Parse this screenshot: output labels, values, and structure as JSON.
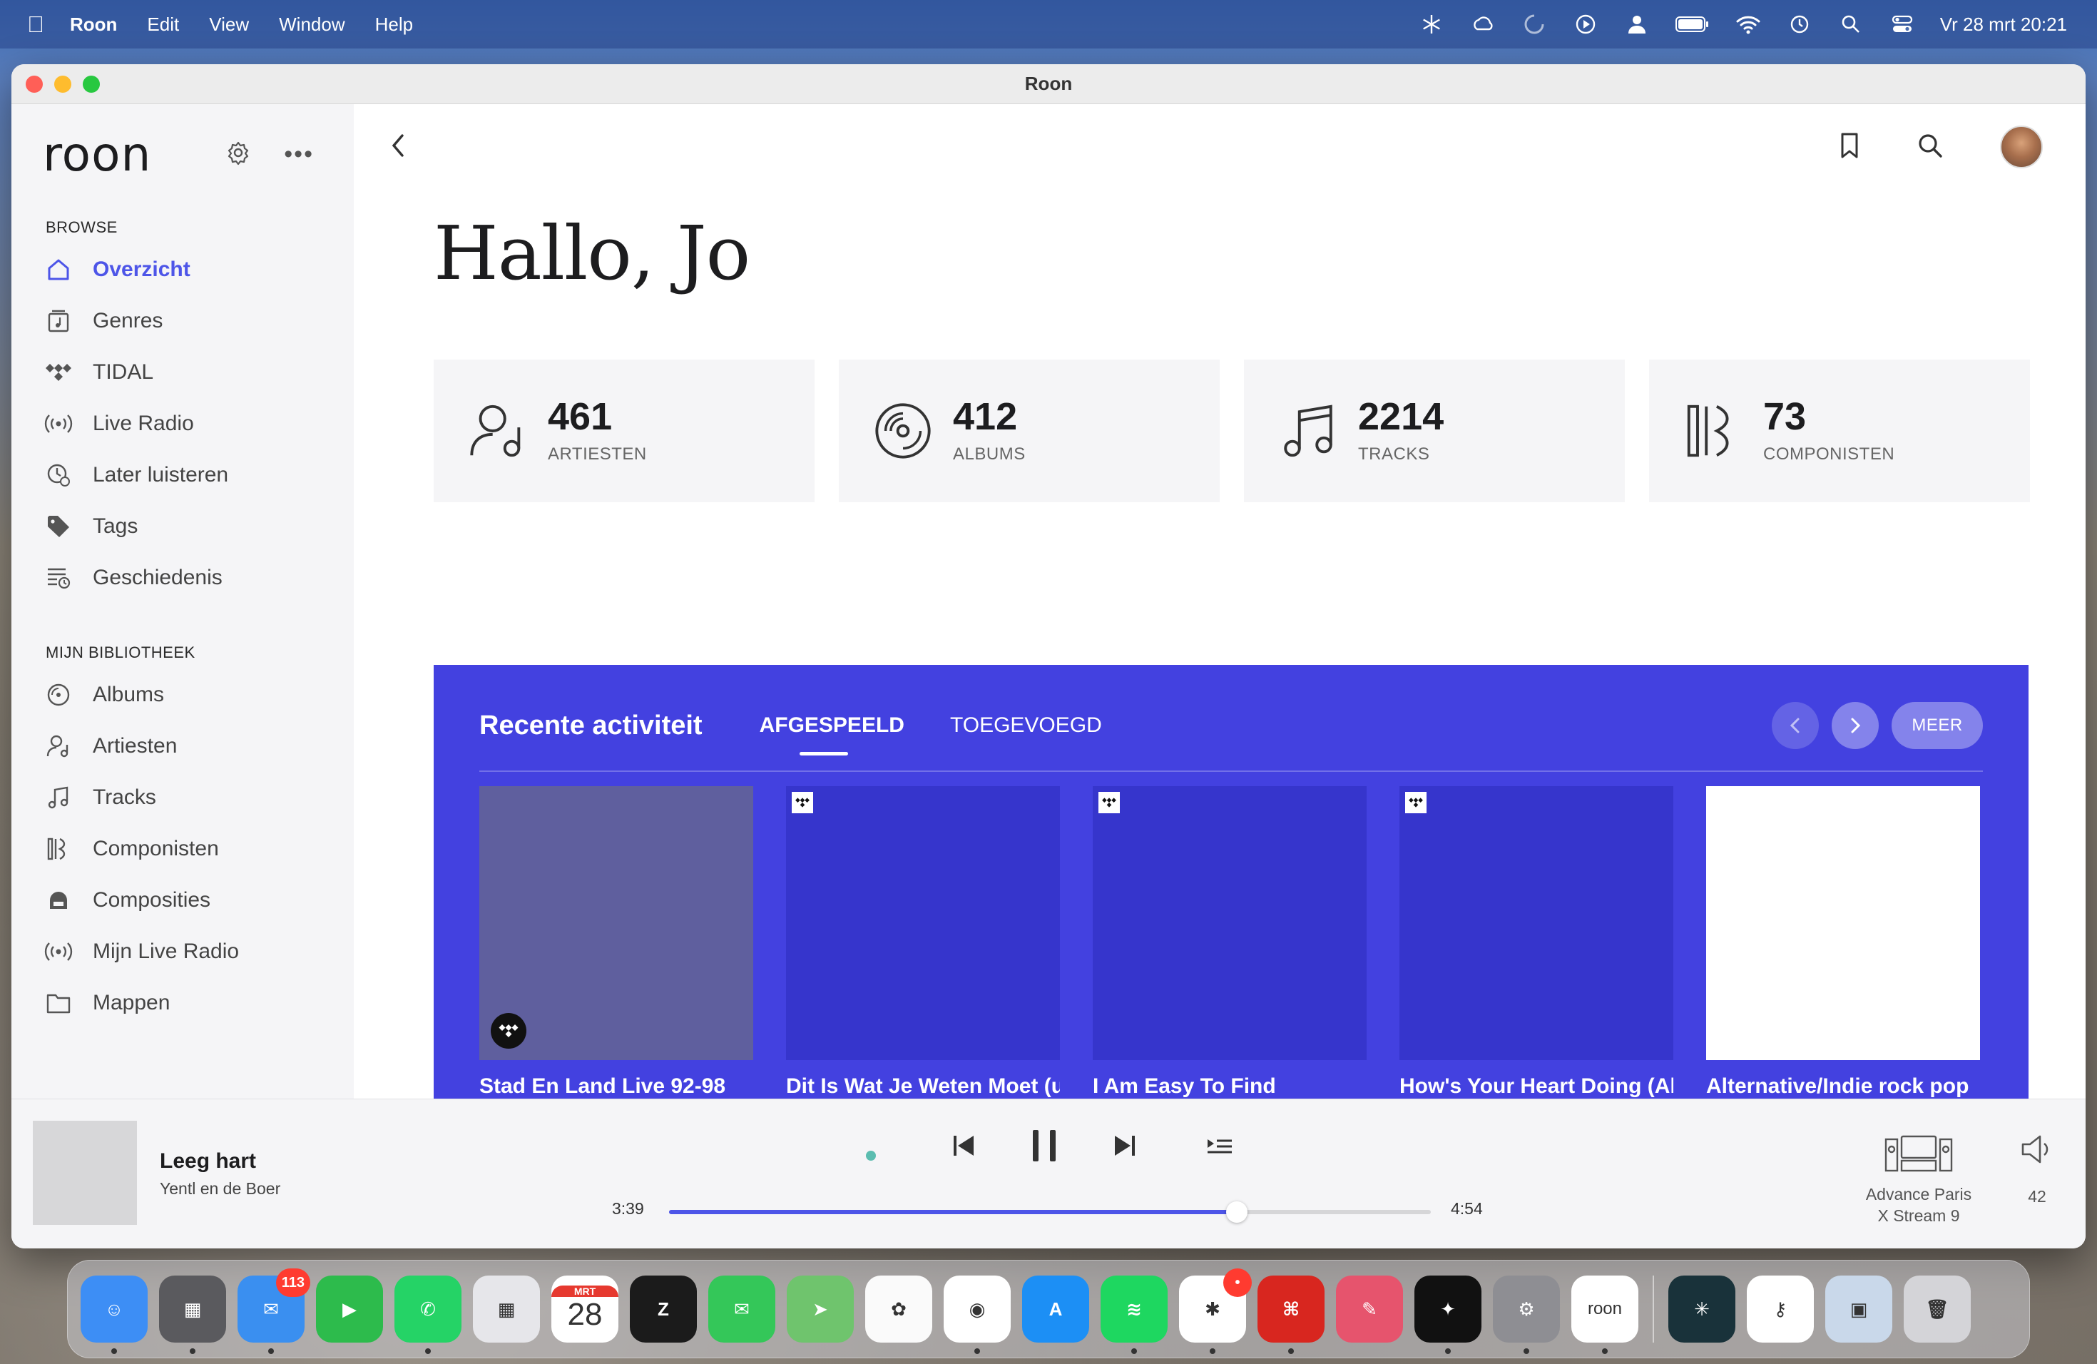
{
  "menubar": {
    "app_name": "Roon",
    "menus": [
      "Edit",
      "View",
      "Window",
      "Help"
    ],
    "clock": "Vr 28 mrt  20:21"
  },
  "window": {
    "title": "Roon"
  },
  "sidebar": {
    "logo": "roon",
    "browse_label": "BROWSE",
    "browse_items": [
      {
        "label": "Overzicht",
        "icon": "home-icon",
        "active": true
      },
      {
        "label": "Genres",
        "icon": "genres-icon"
      },
      {
        "label": "TIDAL",
        "icon": "tidal-icon"
      },
      {
        "label": "Live Radio",
        "icon": "radio-icon"
      },
      {
        "label": "Later luisteren",
        "icon": "later-icon"
      },
      {
        "label": "Tags",
        "icon": "tag-icon"
      },
      {
        "label": "Geschiedenis",
        "icon": "history-icon"
      }
    ],
    "library_label": "MIJN BIBLIOTHEEK",
    "library_items": [
      {
        "label": "Albums",
        "icon": "album-icon"
      },
      {
        "label": "Artiesten",
        "icon": "artist-icon"
      },
      {
        "label": "Tracks",
        "icon": "track-icon"
      },
      {
        "label": "Componisten",
        "icon": "composer-icon"
      },
      {
        "label": "Composities",
        "icon": "composition-icon"
      },
      {
        "label": "Mijn Live Radio",
        "icon": "radio-icon"
      },
      {
        "label": "Mappen",
        "icon": "folder-icon"
      }
    ]
  },
  "main": {
    "greeting": "Hallo, Jo",
    "stats": [
      {
        "value": "461",
        "label": "ARTIESTEN",
        "icon": "artist-icon"
      },
      {
        "value": "412",
        "label": "ALBUMS",
        "icon": "album-icon"
      },
      {
        "value": "2214",
        "label": "TRACKS",
        "icon": "track-icon"
      },
      {
        "value": "73",
        "label": "COMPONISTEN",
        "icon": "composer-icon"
      }
    ],
    "activity": {
      "title": "Recente activiteit",
      "tabs": [
        {
          "label": "AFGESPEELD",
          "active": true
        },
        {
          "label": "TOEGEVOEGD",
          "active": false
        }
      ],
      "more_label": "MEER",
      "cards": [
        {
          "title": "Stad En Land Live 92-98",
          "color": "#5f5f9e",
          "badge": "large"
        },
        {
          "title": "Dit Is Wat Je Weten Moet (u",
          "color": "#3635cc",
          "badge": "small"
        },
        {
          "title": "I Am Easy To Find",
          "color": "#3635cc",
          "badge": "small"
        },
        {
          "title": "How's Your Heart Doing (Alb",
          "color": "#3635cc",
          "badge": "small"
        },
        {
          "title": "Alternative/Indie rock pop",
          "color": "#ffffff",
          "badge": "none"
        }
      ]
    }
  },
  "player": {
    "title": "Leeg hart",
    "artist": "Yentl en de Boer",
    "elapsed": "3:39",
    "duration": "4:54",
    "progress": 0.7449,
    "zone_line1": "Advance Paris",
    "zone_line2": "X Stream 9",
    "volume": "42"
  },
  "dock": {
    "apps": [
      {
        "name": "Finder",
        "color": "#3d8ef5",
        "glyph": "☺",
        "running": true
      },
      {
        "name": "Calculator",
        "color": "#5a5a5e",
        "glyph": "▦",
        "running": true
      },
      {
        "name": "Mail",
        "color": "#3a8ff0",
        "glyph": "✉",
        "badge": "113",
        "running": true
      },
      {
        "name": "FaceTime",
        "color": "#2dbb4c",
        "glyph": "▶"
      },
      {
        "name": "WhatsApp",
        "color": "#25d366",
        "glyph": "✆",
        "running": true
      },
      {
        "name": "Launchpad",
        "color": "#e6e6ea",
        "glyph": "▦"
      },
      {
        "name": "Calendar",
        "color": "#ffffff",
        "glyph": "28",
        "sub": "MRT"
      },
      {
        "name": "Ziggo",
        "color": "#1b1b1b",
        "glyph": "Z"
      },
      {
        "name": "Messages",
        "color": "#34c759",
        "glyph": "✉"
      },
      {
        "name": "Maps",
        "color": "#6fc46d",
        "glyph": "➤"
      },
      {
        "name": "Photos",
        "color": "#fafafa",
        "glyph": "✿"
      },
      {
        "name": "Chrome",
        "color": "#ffffff",
        "glyph": "◉",
        "running": true
      },
      {
        "name": "App Store",
        "color": "#1c8ff5",
        "glyph": "A"
      },
      {
        "name": "Spotify",
        "color": "#1ed760",
        "glyph": "≋",
        "running": true
      },
      {
        "name": "Slack",
        "color": "#ffffff",
        "glyph": "✱",
        "badge": "•",
        "running": true
      },
      {
        "name": "Acrobat",
        "color": "#d8261f",
        "glyph": "⌘",
        "running": true
      },
      {
        "name": "CleanMyMac",
        "color": "#e6546d",
        "glyph": "✎"
      },
      {
        "name": "TIDAL",
        "color": "#111111",
        "glyph": "✦",
        "running": true
      },
      {
        "name": "System Settings",
        "color": "#8e8e93",
        "glyph": "⚙",
        "running": true
      },
      {
        "name": "Roon",
        "color": "#ffffff",
        "glyph": "roon",
        "running": true
      }
    ],
    "apps_right": [
      {
        "name": "Perplexity",
        "color": "#19323a",
        "glyph": "✳"
      },
      {
        "name": "Passwords",
        "color": "#ffffff",
        "glyph": "⚷"
      },
      {
        "name": "Preview",
        "color": "#c9d8ea",
        "glyph": "▣"
      },
      {
        "name": "Trash",
        "color": "#d4d4d8",
        "glyph": "🗑"
      }
    ]
  }
}
